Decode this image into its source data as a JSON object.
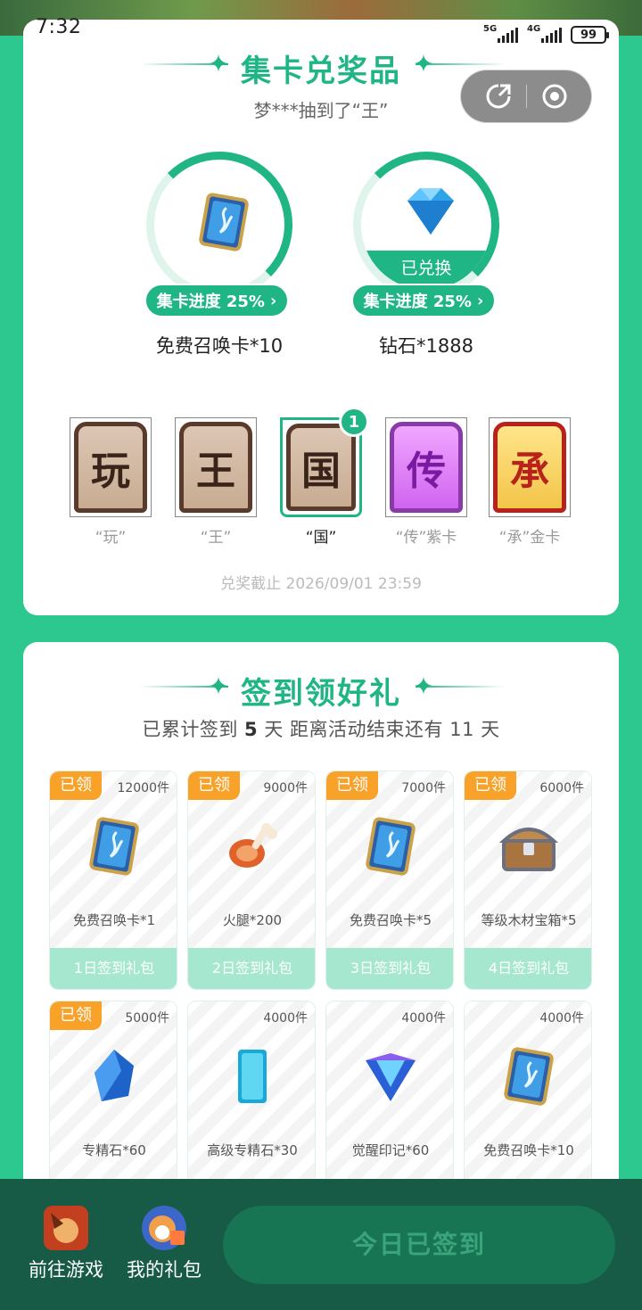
{
  "status": {
    "time": "7:32",
    "net1": "5G",
    "net2": "4G",
    "battery": "99"
  },
  "collect": {
    "title": "集卡兑奖品",
    "ticker": "梦***抽到了“王”",
    "prizes": [
      {
        "name": "免费召唤卡*10",
        "progress_label": "集卡进度 25%",
        "progress": 0.25,
        "status": "",
        "icon": "summon-card-icon"
      },
      {
        "name": "钻石*1888",
        "progress_label": "集卡进度 25%",
        "progress": 0.25,
        "status": "已兑换",
        "icon": "diamond-icon"
      }
    ],
    "cards": [
      {
        "char": "玩",
        "label": "“玩”",
        "count": "",
        "style": "brown"
      },
      {
        "char": "王",
        "label": "“王”",
        "count": "",
        "style": "brown"
      },
      {
        "char": "国",
        "label": "“国”",
        "count": "1",
        "style": "brown"
      },
      {
        "char": "传",
        "label": "“传”紫卡",
        "count": "",
        "style": "purple"
      },
      {
        "char": "承",
        "label": "“承”金卡",
        "count": "",
        "style": "gold"
      }
    ],
    "deadline": "兑奖截止 2026/09/01 23:59"
  },
  "signin": {
    "title": "签到领好礼",
    "meta_prefix": "已累计签到",
    "days_signed": "5",
    "meta_mid": "天  距离活动结束还有",
    "days_left": "11",
    "meta_suffix": "天",
    "gifts": [
      {
        "claimed": "已领",
        "count": "12000件",
        "name": "免费召唤卡*1",
        "day": "1日签到礼包",
        "icon": "summon-card-icon"
      },
      {
        "claimed": "已领",
        "count": "9000件",
        "name": "火腿*200",
        "day": "2日签到礼包",
        "icon": "ham-icon"
      },
      {
        "claimed": "已领",
        "count": "7000件",
        "name": "免费召唤卡*5",
        "day": "3日签到礼包",
        "icon": "summon-card-icon"
      },
      {
        "claimed": "已领",
        "count": "6000件",
        "name": "等级木材宝箱*5",
        "day": "4日签到礼包",
        "icon": "treasure-chest-icon"
      },
      {
        "claimed": "已领",
        "count": "5000件",
        "name": "专精石*60",
        "day": "",
        "icon": "blue-gem-icon"
      },
      {
        "claimed": "",
        "count": "4000件",
        "name": "高级专精石*30",
        "day": "",
        "icon": "crystal-block-icon"
      },
      {
        "claimed": "",
        "count": "4000件",
        "name": "觉醒印记*60",
        "day": "",
        "icon": "awakening-mark-icon"
      },
      {
        "claimed": "",
        "count": "4000件",
        "name": "免费召唤卡*10",
        "day": "",
        "icon": "summon-card-icon"
      }
    ]
  },
  "bottom": {
    "go_game": "前往游戏",
    "my_gifts": "我的礼包",
    "signed_today": "今日已签到"
  }
}
